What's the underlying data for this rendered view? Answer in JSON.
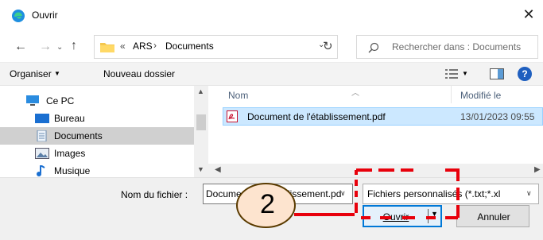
{
  "window": {
    "title": "Ouvrir",
    "close_glyph": "✕"
  },
  "nav": {
    "back": "←",
    "forward": "→",
    "recent": "⌄",
    "up": "↑",
    "refresh": "↻"
  },
  "address": {
    "separator": "«",
    "part1": "ARS",
    "arrow": "›",
    "part2": "Documents",
    "dropdown": "⌄"
  },
  "search": {
    "placeholder": "Rechercher dans : Documents"
  },
  "toolbar": {
    "organize": "Organiser",
    "new_folder": "Nouveau dossier",
    "help": "?"
  },
  "sidebar": {
    "items": [
      {
        "label": "Ce PC",
        "icon": "computer-icon"
      },
      {
        "label": "Bureau",
        "icon": "desktop-icon"
      },
      {
        "label": "Documents",
        "icon": "documents-icon",
        "selected": true
      },
      {
        "label": "Images",
        "icon": "images-icon"
      },
      {
        "label": "Musique",
        "icon": "music-icon"
      }
    ]
  },
  "files": {
    "columns": {
      "name": "Nom",
      "date": "Modifié le"
    },
    "rows": [
      {
        "name": "Document de l'établissement.pdf",
        "modified": "13/01/2023 09:55",
        "icon": "pdf-icon",
        "selected": true
      }
    ]
  },
  "bottom": {
    "filename_label": "Nom du fichier :",
    "filename_value": "Document de l'établissement.pdf",
    "filter_value": "Fichiers personnalisés (*.txt;*.xl",
    "open_label": "Ouvrir",
    "cancel_label": "Annuler"
  },
  "annotation": {
    "step": "2",
    "color": "#e8000b"
  },
  "colors": {
    "accent": "#0078d7",
    "selection": "#cce8ff"
  }
}
